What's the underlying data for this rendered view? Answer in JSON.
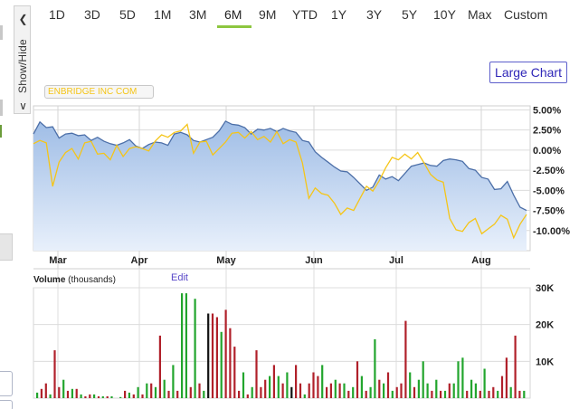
{
  "range_tabs": [
    {
      "label": "1D",
      "x": 54
    },
    {
      "label": "3D",
      "x": 93
    },
    {
      "label": "5D",
      "x": 132
    },
    {
      "label": "1M",
      "x": 170
    },
    {
      "label": "3M",
      "x": 209
    },
    {
      "label": "6M",
      "x": 248,
      "active": true
    },
    {
      "label": "9M",
      "x": 286
    },
    {
      "label": "YTD",
      "x": 323
    },
    {
      "label": "1Y",
      "x": 366
    },
    {
      "label": "3Y",
      "x": 405
    },
    {
      "label": "5Y",
      "x": 444
    },
    {
      "label": "10Y",
      "x": 479
    },
    {
      "label": "Max",
      "x": 517
    },
    {
      "label": "Custom",
      "x": 557
    }
  ],
  "show_hide_label": "Show/Hide",
  "large_chart_label": "Large Chart",
  "legend_label": "ENBRIDGE INC COM",
  "edit_label": "Edit",
  "volume_title_bold": "Volume",
  "volume_title_rest": " (thousands)",
  "colors": {
    "area_fill_top": "#9fbde6",
    "area_fill_bottom": "#e8f0fb",
    "area_line": "#4c6fa8",
    "compare_line": "#f5c518",
    "volume_up": "#22a52d",
    "volume_down": "#b0202a",
    "volume_neutral": "#111111",
    "active_tab_underline": "#8dc63f",
    "large_chart_text": "#2f27b8"
  },
  "chart_data": [
    {
      "type": "area",
      "series": [
        {
          "name": "",
          "values": [
            2.0,
            3.5,
            2.8,
            2.9,
            1.5,
            2.0,
            2.1,
            1.8,
            1.9,
            1.2,
            1.6,
            1.1,
            0.8,
            0.6,
            0.9,
            1.3,
            0.5,
            0.2,
            0.7,
            1.0,
            0.9,
            0.6,
            2.0,
            2.2,
            1.9,
            1.2,
            1.0,
            1.3,
            1.6,
            2.4,
            3.6,
            3.2,
            3.1,
            2.8,
            2.0,
            2.6,
            2.5,
            2.7,
            2.3,
            2.7,
            2.4,
            2.2,
            1.2,
            1.0,
            -0.2,
            -0.9,
            -1.5,
            -2.1,
            -2.6,
            -2.7,
            -3.4,
            -4.2,
            -5.0,
            -4.6,
            -3.1,
            -3.6,
            -3.3,
            -3.8,
            -2.9,
            -2.0,
            -1.8,
            -1.6,
            -1.9,
            -2.0,
            -1.3,
            -1.1,
            -1.2,
            -1.4,
            -2.3,
            -2.5,
            -3.4,
            -3.6,
            -4.9,
            -4.8,
            -3.9,
            -5.6,
            -7.1,
            -7.5
          ]
        },
        {
          "name": "",
          "values": [
            0.8,
            1.2,
            0.9,
            -4.5,
            -1.5,
            -0.3,
            0.2,
            -1.1,
            0.9,
            1.1,
            -0.5,
            -0.4,
            -1.2,
            0.6,
            -0.8,
            0.2,
            0.4,
            0.2,
            -0.1,
            1.1,
            1.9,
            1.6,
            2.2,
            2.4,
            3.2,
            -0.4,
            1.0,
            1.1,
            -0.6,
            0.2,
            1.0,
            2.1,
            2.2,
            1.5,
            2.3,
            1.3,
            1.7,
            1.0,
            2.3,
            0.8,
            1.3,
            1.0,
            -1.6,
            -6.0,
            -4.7,
            -5.4,
            -5.6,
            -6.6,
            -8.0,
            -7.2,
            -7.5,
            -6.0,
            -4.5,
            -5.1,
            -3.8,
            -2.2,
            -0.9,
            -1.2,
            -0.5,
            -1.1,
            -0.3,
            -1.6,
            -3.0,
            -3.7,
            -4.0,
            -8.5,
            -9.9,
            -10.1,
            -9.0,
            -8.5,
            -10.4,
            -9.8,
            -9.2,
            -8.1,
            -8.6,
            -10.9,
            -9.2,
            -8.0
          ]
        }
      ],
      "x_ticks": [
        "Mar",
        "Apr",
        "May",
        "Jun",
        "Jul",
        "Aug"
      ],
      "y_ticks": [
        "5.00%",
        "2.50%",
        "0.00%",
        "-2.50%",
        "-5.00%",
        "-7.50%",
        "-10.00%"
      ],
      "y_tick_values": [
        5,
        2.5,
        0,
        -2.5,
        -5,
        -7.5,
        -10
      ],
      "ylim": [
        -12.5,
        5.5
      ],
      "grid": true
    },
    {
      "type": "bar",
      "title": "Volume (thousands)",
      "y_ticks": [
        "30K",
        "20K",
        "10K"
      ],
      "y_tick_values": [
        30,
        20,
        10
      ],
      "ylim": [
        0,
        30
      ],
      "values": [
        1.5,
        2.5,
        4,
        1,
        13,
        3,
        5,
        2,
        2.5,
        2.5,
        1,
        0.5,
        1,
        1,
        0.5,
        0.5,
        0.5,
        0.5,
        0,
        0.3,
        2,
        1.5,
        1,
        3,
        1,
        4,
        4,
        3,
        17,
        5,
        2,
        9,
        2,
        28.5,
        28.5,
        3,
        27,
        4,
        2,
        23,
        23,
        22,
        18,
        24,
        19,
        14,
        2,
        7,
        1,
        3,
        13,
        3,
        5,
        6,
        9,
        6,
        4,
        7,
        3,
        9,
        4,
        1,
        4,
        7,
        6,
        9,
        3,
        4,
        5,
        4,
        4,
        2,
        3,
        10,
        6,
        2,
        3,
        16,
        5,
        4,
        7,
        2,
        3,
        4,
        21,
        7,
        3,
        5,
        10,
        4,
        2,
        5,
        2,
        2,
        4,
        4,
        10,
        11,
        2,
        5,
        4,
        2,
        8,
        2,
        3,
        2,
        6,
        11,
        3,
        17,
        2,
        2
      ],
      "colors": [
        "u",
        "d",
        "d",
        "u",
        "d",
        "d",
        "u",
        "d",
        "u",
        "d",
        "u",
        "d",
        "d",
        "u",
        "d",
        "u",
        "d",
        "u",
        "d",
        "u",
        "d",
        "u",
        "d",
        "u",
        "d",
        "u",
        "d",
        "u",
        "d",
        "u",
        "d",
        "u",
        "d",
        "u",
        "u",
        "d",
        "u",
        "d",
        "u",
        "n",
        "d",
        "d",
        "u",
        "d",
        "d",
        "d",
        "d",
        "u",
        "d",
        "u",
        "d",
        "d",
        "d",
        "u",
        "d",
        "u",
        "d",
        "u",
        "n",
        "d",
        "d",
        "u",
        "d",
        "d",
        "d",
        "u",
        "d",
        "d",
        "u",
        "d",
        "u",
        "d",
        "u",
        "d",
        "u",
        "d",
        "u",
        "u",
        "d",
        "u",
        "d",
        "u",
        "d",
        "d",
        "d",
        "u",
        "d",
        "u",
        "u",
        "u",
        "d",
        "u",
        "d",
        "u",
        "d",
        "u",
        "u",
        "u",
        "d",
        "u",
        "u",
        "d",
        "u",
        "d",
        "d",
        "u",
        "d",
        "d",
        "u",
        "d",
        "d",
        "u"
      ]
    }
  ]
}
